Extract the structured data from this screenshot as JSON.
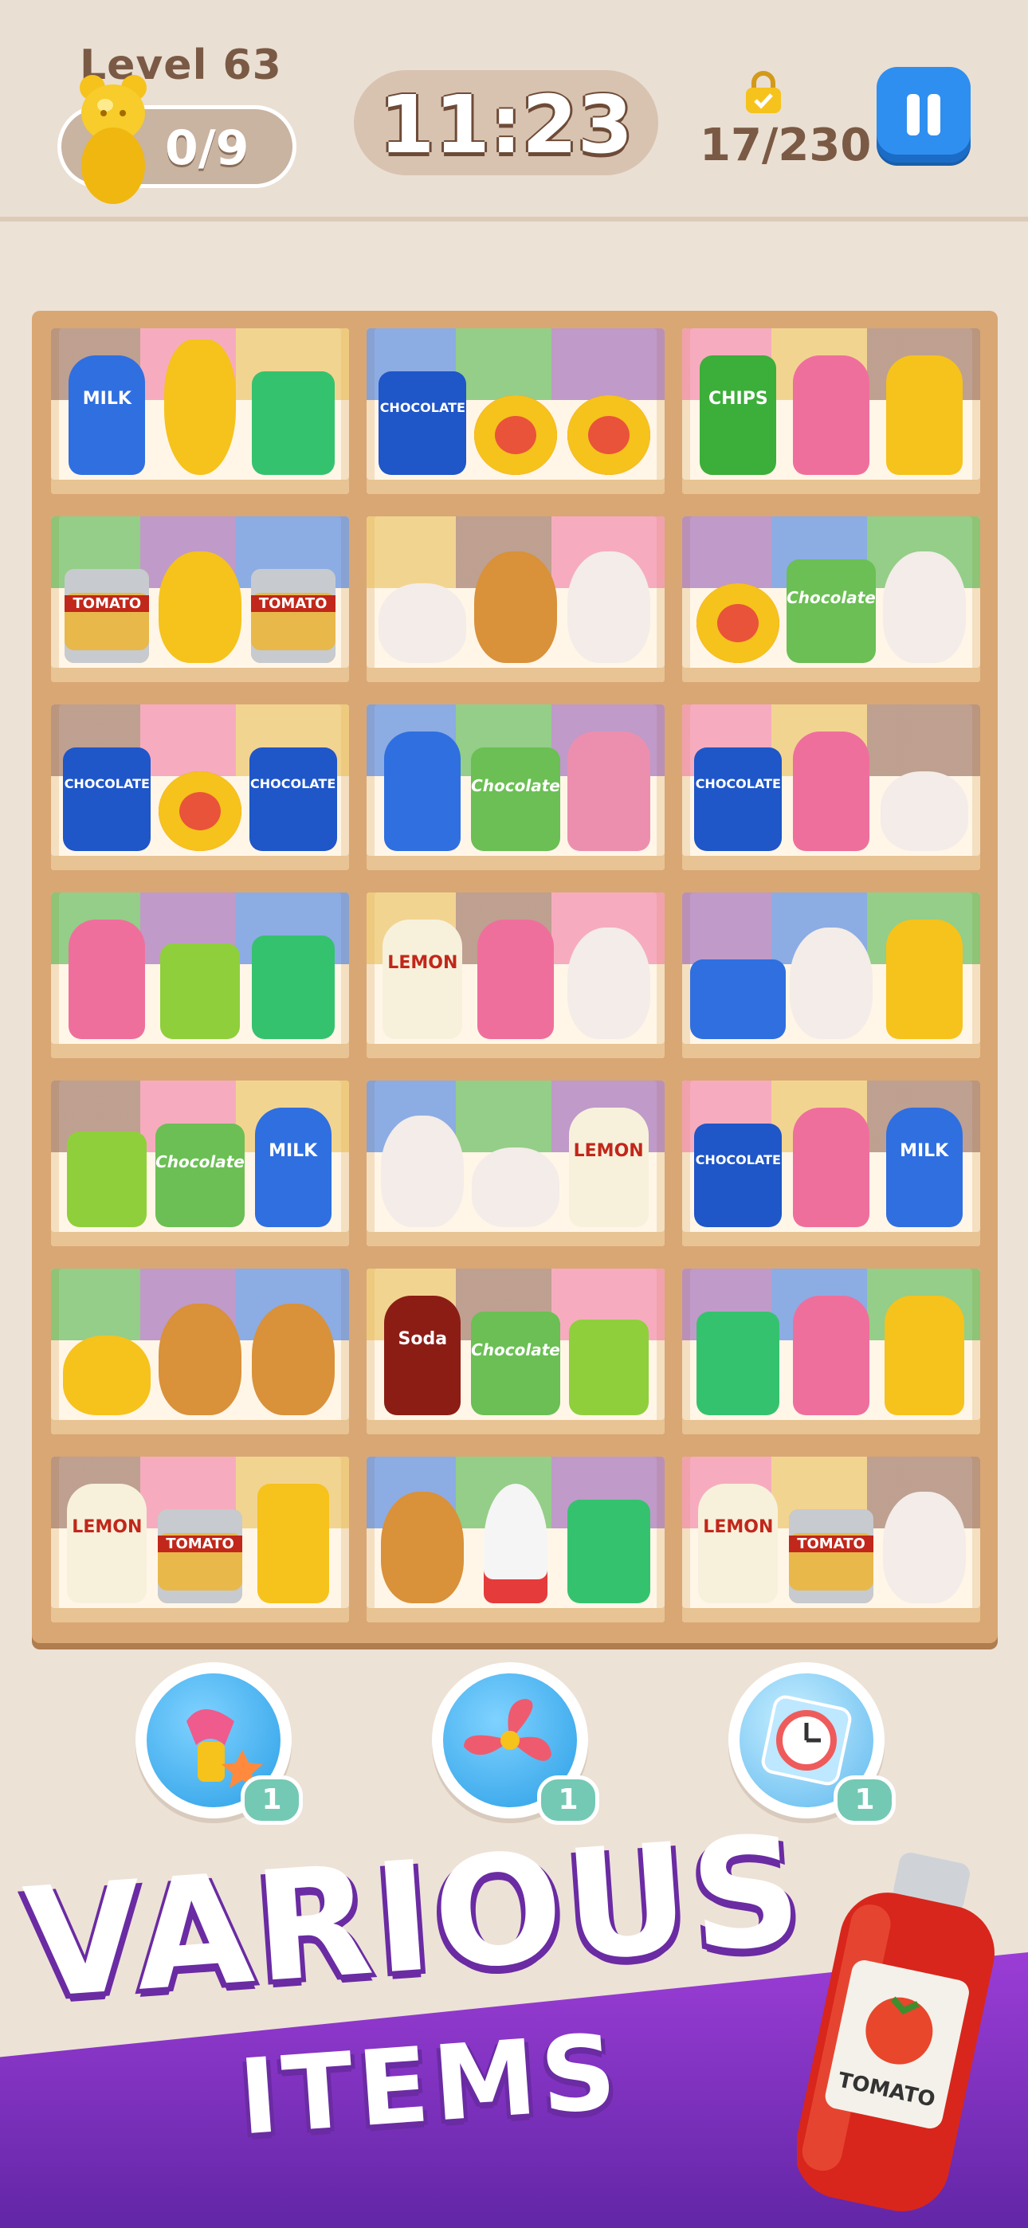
{
  "hud": {
    "level_label": "Level  63",
    "collect_progress": "0/9",
    "timer": "11:23",
    "coins": "17/230"
  },
  "shelf_labels": {
    "milk": "MILK",
    "chocolate": "CHOCOLATE",
    "tomato": "TOMATO",
    "chips": "CHIPS",
    "choco_bar": "Chocolate",
    "lemon": "LEMON",
    "soda": "Soda"
  },
  "boosters": [
    {
      "name": "magnet-booster",
      "count": "1"
    },
    {
      "name": "fan-booster",
      "count": "1"
    },
    {
      "name": "freeze-clock-booster",
      "count": "1"
    }
  ],
  "promo": {
    "line1": "VARIOUS",
    "line2": "ITEMS",
    "ketchup_label": "TOMATO"
  },
  "colors": {
    "pause": "#2e8ff0",
    "shelf": "#d9a774",
    "promo_purple": "#7a2fc0"
  }
}
